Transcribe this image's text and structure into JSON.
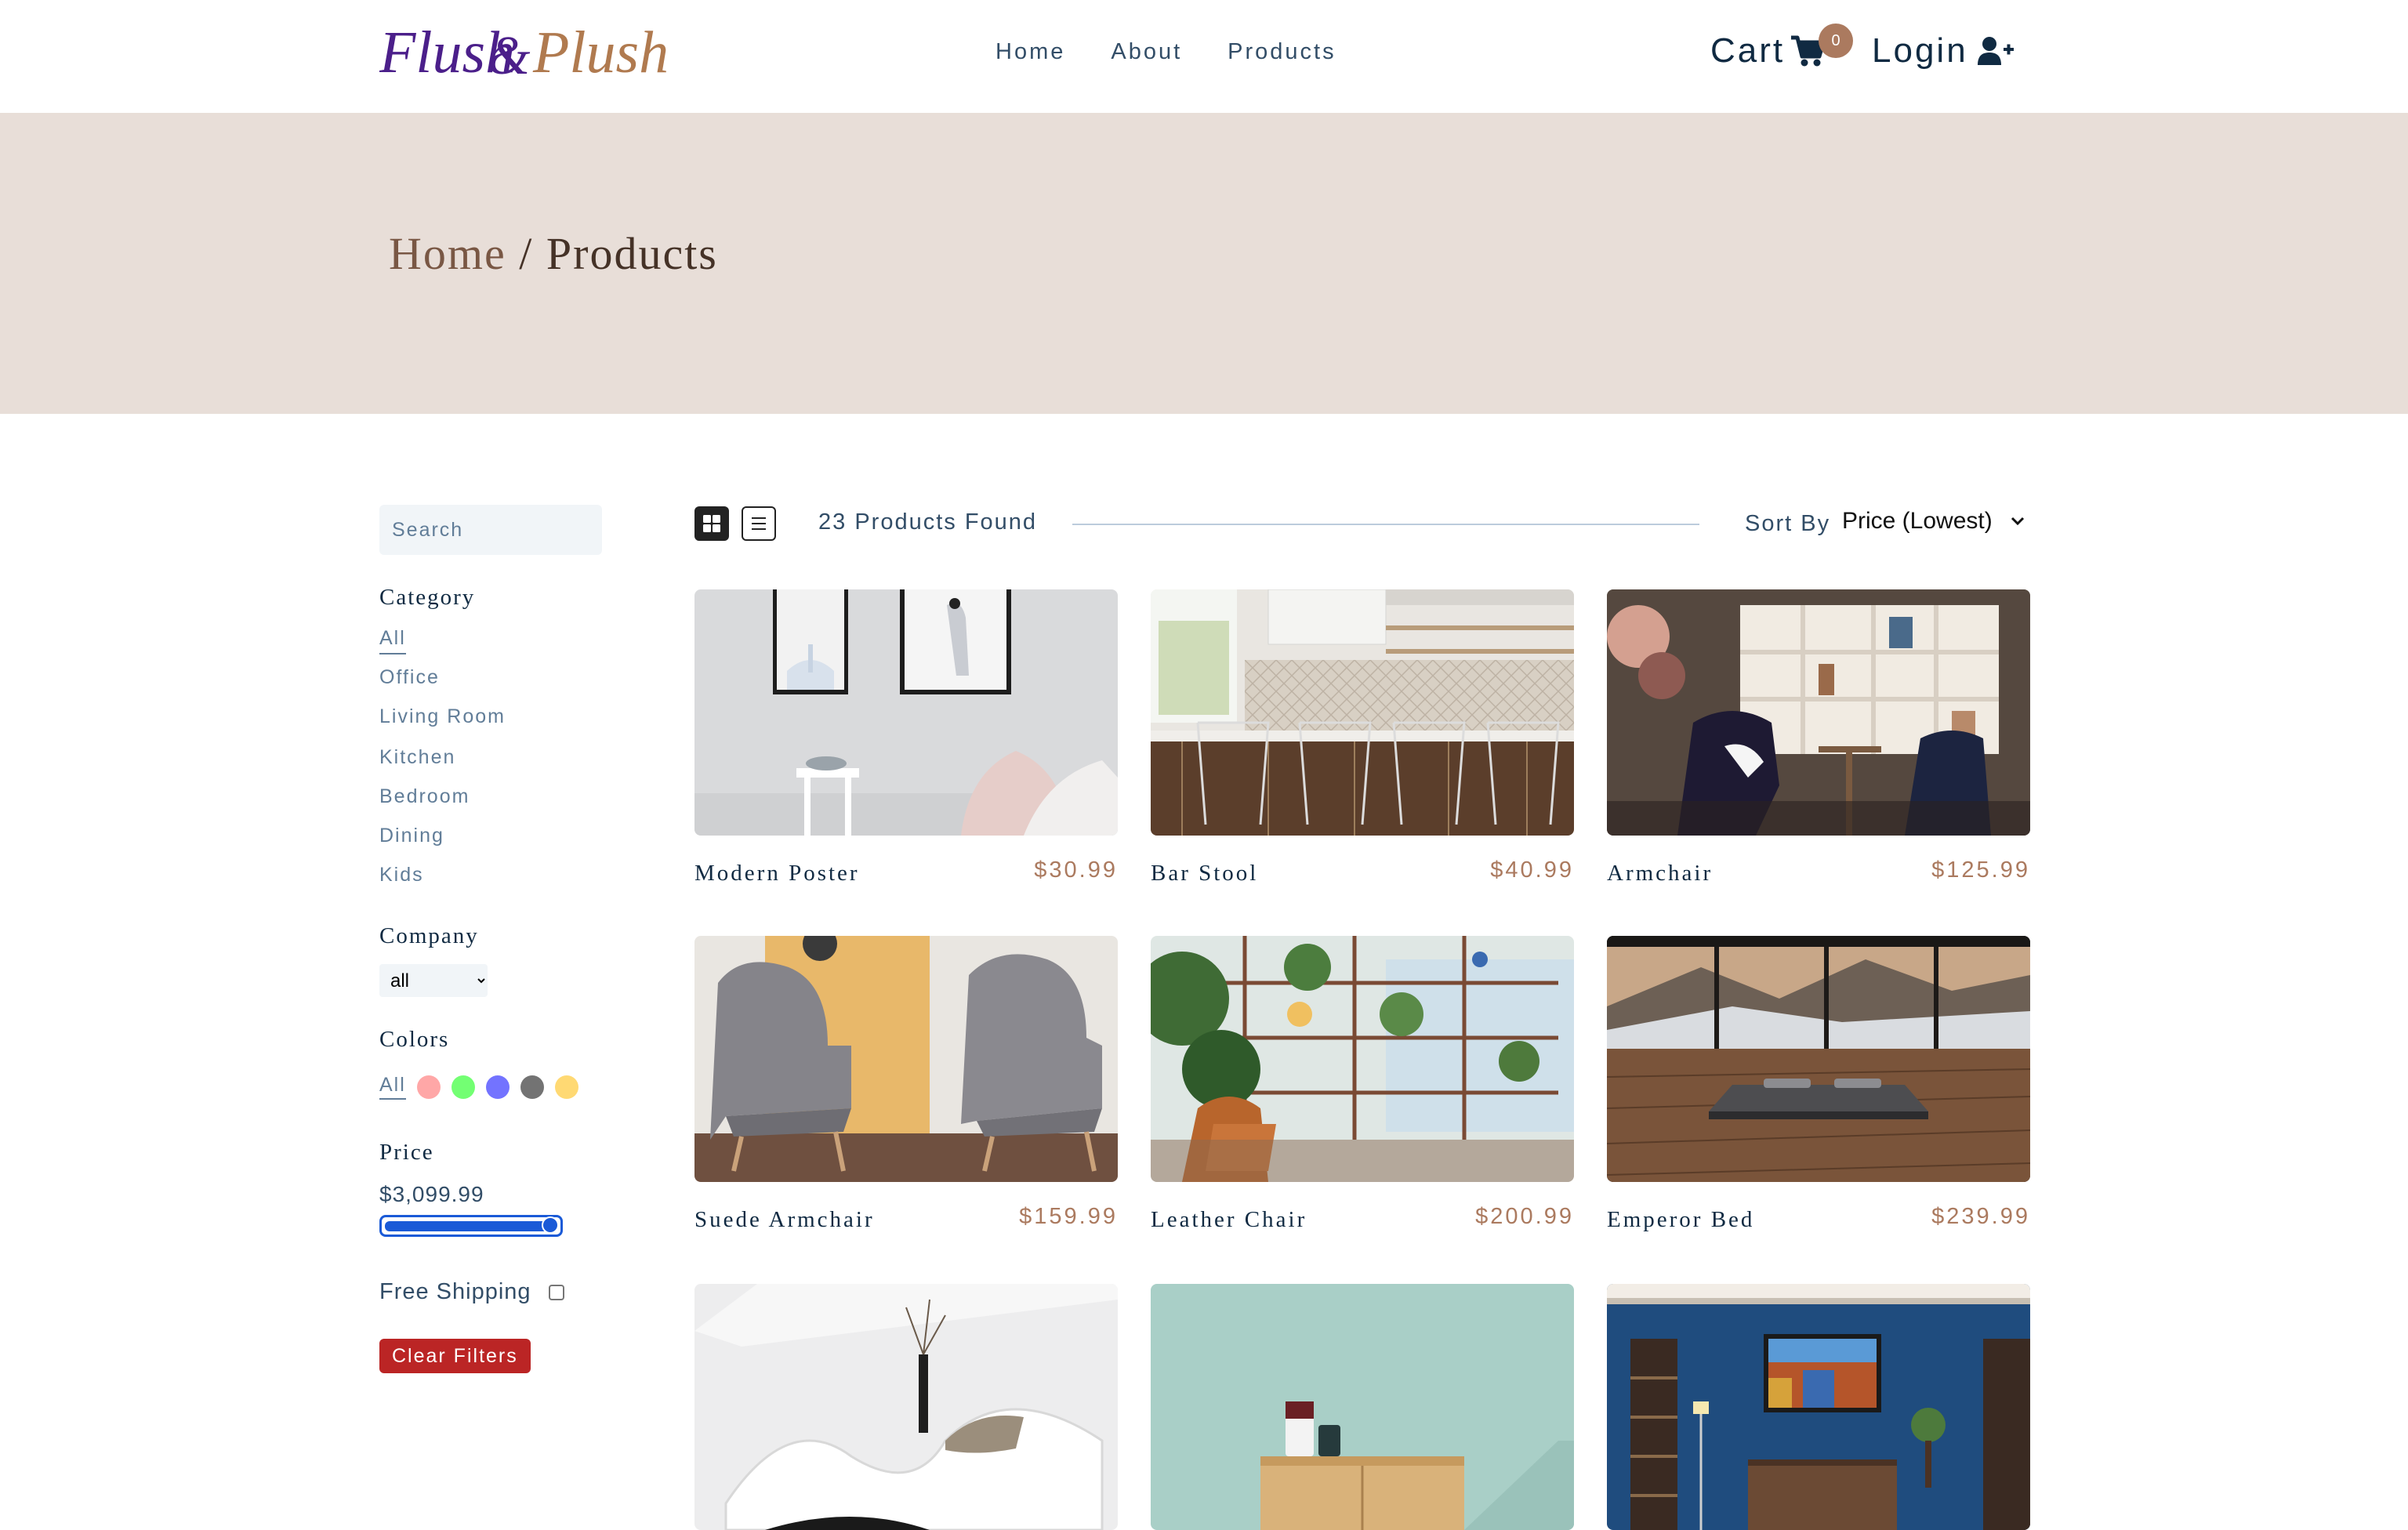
{
  "brand": {
    "logo_text": "Flush & Plush",
    "logo_colors": [
      "#4b1f8a",
      "#b07a4f"
    ]
  },
  "nav": {
    "links": [
      "Home",
      "About",
      "Products"
    ]
  },
  "header": {
    "cart_label": "Cart",
    "cart_count": "0",
    "login_label": "Login"
  },
  "breadcrumb": {
    "home": "Home",
    "separator": " / ",
    "current": "Products"
  },
  "filters": {
    "search_placeholder": "Search",
    "category_title": "Category",
    "categories": [
      "All",
      "Office",
      "Living Room",
      "Kitchen",
      "Bedroom",
      "Dining",
      "Kids"
    ],
    "active_category": "All",
    "company_title": "Company",
    "company_selected": "all",
    "colors_title": "Colors",
    "colors_all": "All",
    "colors": [
      "#ff5f5f",
      "#00ff00",
      "#0000ff",
      "#000000",
      "#ffb900"
    ],
    "price_title": "Price",
    "price_value": "$3,099.99",
    "price_fill_percent": 100,
    "free_shipping_label": "Free Shipping",
    "free_shipping_checked": false,
    "clear_label": "Clear Filters"
  },
  "toolbar": {
    "view_mode": "grid",
    "count_text": "23 Products Found",
    "sort_label": "Sort By",
    "sort_value": "Price (Lowest)"
  },
  "products": [
    {
      "name": "Modern Poster",
      "price": "$30.99",
      "scene": "poster"
    },
    {
      "name": "Bar Stool",
      "price": "$40.99",
      "scene": "kitchen"
    },
    {
      "name": "Armchair",
      "price": "$125.99",
      "scene": "shelves"
    },
    {
      "name": "Suede Armchair",
      "price": "$159.99",
      "scene": "suede"
    },
    {
      "name": "Leather Chair",
      "price": "$200.99",
      "scene": "plants"
    },
    {
      "name": "Emperor Bed",
      "price": "$239.99",
      "scene": "bed"
    },
    {
      "name": "",
      "price": "",
      "scene": "lounge"
    },
    {
      "name": "",
      "price": "",
      "scene": "cabinet"
    },
    {
      "name": "",
      "price": "",
      "scene": "blue-room"
    }
  ]
}
